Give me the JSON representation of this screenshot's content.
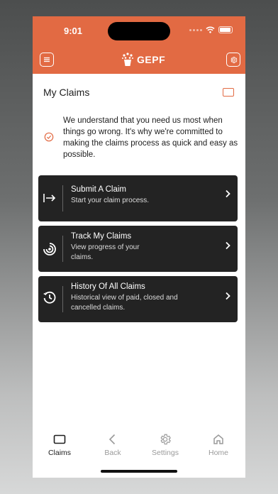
{
  "status_bar": {
    "time": "9:01"
  },
  "header": {
    "brand": "GEPF"
  },
  "page": {
    "title": "My Claims"
  },
  "intro": {
    "text": "We understand that you need us most when things go wrong. It's why we're committed to making the claims process as quick and easy as possible."
  },
  "cards": [
    {
      "title": "Submit A Claim",
      "subtitle": "Start your claim process."
    },
    {
      "title": "Track My Claims",
      "subtitle": "View progress of your claims."
    },
    {
      "title": "History Of All Claims",
      "subtitle": "Historical view of paid, closed and cancelled claims."
    }
  ],
  "tabs": [
    {
      "label": "Claims",
      "icon": "claims-icon",
      "active": true
    },
    {
      "label": "Back",
      "icon": "chevron-left-icon"
    },
    {
      "label": "Settings",
      "icon": "gear-icon"
    },
    {
      "label": "Home",
      "icon": "home-icon"
    }
  ],
  "colors": {
    "brand": "#e26a43",
    "card": "#232323"
  }
}
